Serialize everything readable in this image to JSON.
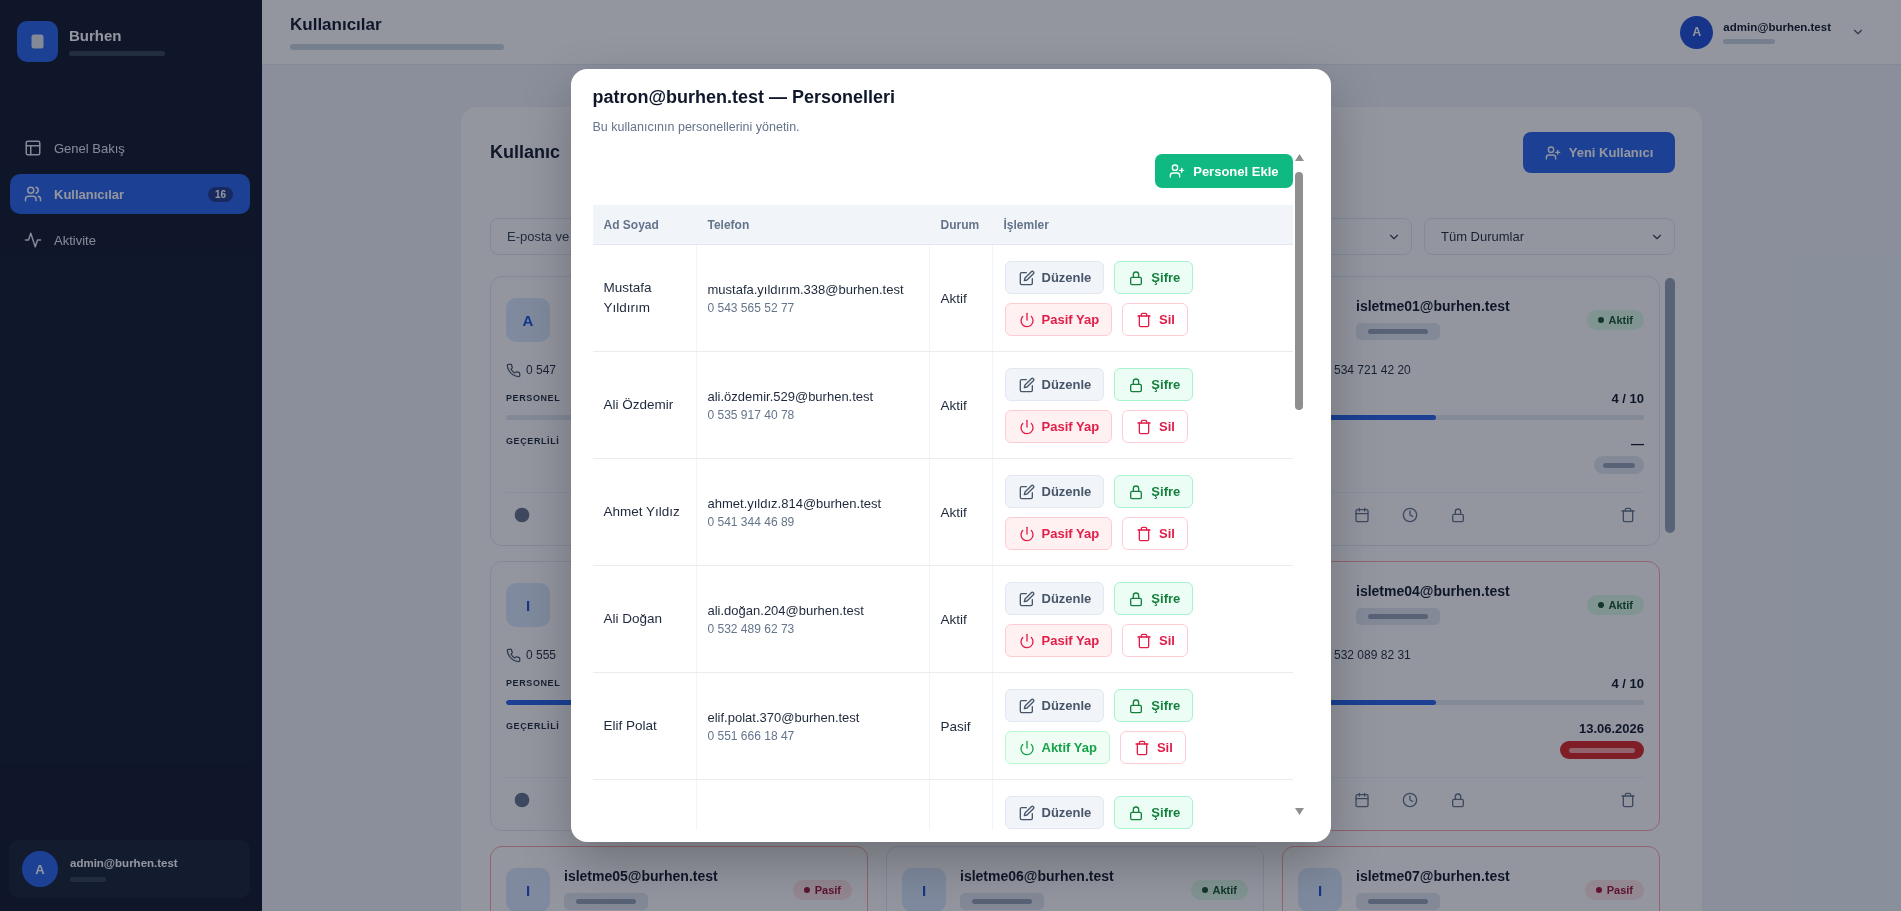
{
  "sidebar": {
    "brand": "Burhen",
    "items": [
      {
        "label": "Genel Bakış",
        "selected": false
      },
      {
        "label": "Kullanıcılar",
        "selected": true,
        "count": "16"
      },
      {
        "label": "Aktivite",
        "selected": false
      }
    ],
    "user": {
      "avatar": "A",
      "email": "admin@burhen.test"
    }
  },
  "header": {
    "title": "Kullanıcılar",
    "user": {
      "avatar": "A",
      "email": "admin@burhen.test"
    }
  },
  "panel": {
    "title": "Kullanıc",
    "new_button": "Yeni Kullanıcı",
    "search": {
      "placeholder": "E-posta ve"
    },
    "status_filter": {
      "value": "Tüm Durumlar"
    },
    "card_rows": [
      {
        "cards": [
          {
            "kind": "left_cut",
            "avatar": "A",
            "phone": "0 547",
            "personnel_label": "PERSONEL",
            "validity_label": "GEÇERLİLİ"
          },
          {
            "kind": "right_cut",
            "email": "isletme01@burhen.test",
            "status": {
              "label": "Aktif",
              "active": true
            },
            "phone": "534 721 42 20",
            "count": "4 / 10",
            "level": 0.4,
            "validity": "—",
            "validity_badge": {
              "expired": false
            }
          }
        ]
      },
      {
        "cards": [
          {
            "kind": "left_cut",
            "avatar": "I",
            "phone": "0 555",
            "personnel_label": "PERSONEL",
            "level": 0.4,
            "validity_label": "GEÇERLİLİ"
          },
          {
            "kind": "right_cut",
            "email": "isletme04@burhen.test",
            "status": {
              "label": "Aktif",
              "active": true
            },
            "phone": "532 089 82 31",
            "count": "4 / 10",
            "level": 0.4,
            "validity": "13.06.2026",
            "validity_badge": {
              "expired": true
            }
          }
        ]
      },
      {
        "cards": [
          {
            "kind": "header_only",
            "avatar": "I",
            "email": "isletme05@burhen.test",
            "status": {
              "label": "Pasif",
              "active": false
            }
          },
          {
            "kind": "header_only",
            "avatar": "I",
            "email": "isletme06@burhen.test",
            "status": {
              "label": "Aktif",
              "active": true
            }
          },
          {
            "kind": "header_only",
            "avatar": "I",
            "email": "isletme07@burhen.test",
            "status": {
              "label": "Pasif",
              "active": false
            }
          }
        ]
      }
    ]
  },
  "modal": {
    "title": "patron@burhen.test — Personelleri",
    "subtitle": "Bu kullanıcının personellerini yönetin.",
    "add_button": "Personel Ekle",
    "table": {
      "columns": [
        "Ad Soyad",
        "Telefon",
        "Durum",
        "İşlemler"
      ],
      "rows": [
        {
          "name": "Mustafa Yıldırım",
          "email": "mustafa.yıldırım.338@burhen.test",
          "phone": "0 543 565 52 77",
          "status": "Aktif",
          "actions": [
            {
              "kind": "edit",
              "label": "Düzenle"
            },
            {
              "kind": "password",
              "label": "Şifre"
            },
            {
              "kind": "deactivate",
              "label": "Pasif Yap"
            },
            {
              "kind": "delete",
              "label": "Sil"
            }
          ]
        },
        {
          "name": "Ali Özdemir",
          "email": "ali.özdemir.529@burhen.test",
          "phone": "0 535 917 40 78",
          "status": "Aktif",
          "actions": [
            {
              "kind": "edit",
              "label": "Düzenle"
            },
            {
              "kind": "password",
              "label": "Şifre"
            },
            {
              "kind": "deactivate",
              "label": "Pasif Yap"
            },
            {
              "kind": "delete",
              "label": "Sil"
            }
          ]
        },
        {
          "name": "Ahmet Yıldız",
          "email": "ahmet.yıldız.814@burhen.test",
          "phone": "0 541 344 46 89",
          "status": "Aktif",
          "actions": [
            {
              "kind": "edit",
              "label": "Düzenle"
            },
            {
              "kind": "password",
              "label": "Şifre"
            },
            {
              "kind": "deactivate",
              "label": "Pasif Yap"
            },
            {
              "kind": "delete",
              "label": "Sil"
            }
          ]
        },
        {
          "name": "Ali Doğan",
          "email": "ali.doğan.204@burhen.test",
          "phone": "0 532 489 62 73",
          "status": "Aktif",
          "actions": [
            {
              "kind": "edit",
              "label": "Düzenle"
            },
            {
              "kind": "password",
              "label": "Şifre"
            },
            {
              "kind": "deactivate",
              "label": "Pasif Yap"
            },
            {
              "kind": "delete",
              "label": "Sil"
            }
          ]
        },
        {
          "name": "Elif Polat",
          "email": "elif.polat.370@burhen.test",
          "phone": "0 551 666 18 47",
          "status": "Pasif",
          "actions": [
            {
              "kind": "edit",
              "label": "Düzenle"
            },
            {
              "kind": "password",
              "label": "Şifre"
            },
            {
              "kind": "activate",
              "label": "Aktif Yap"
            },
            {
              "kind": "delete",
              "label": "Sil"
            }
          ]
        },
        {
          "actions": [
            {
              "kind": "edit",
              "label": "Düzenle"
            },
            {
              "kind": "password",
              "label": "Şifre"
            }
          ]
        }
      ]
    }
  }
}
